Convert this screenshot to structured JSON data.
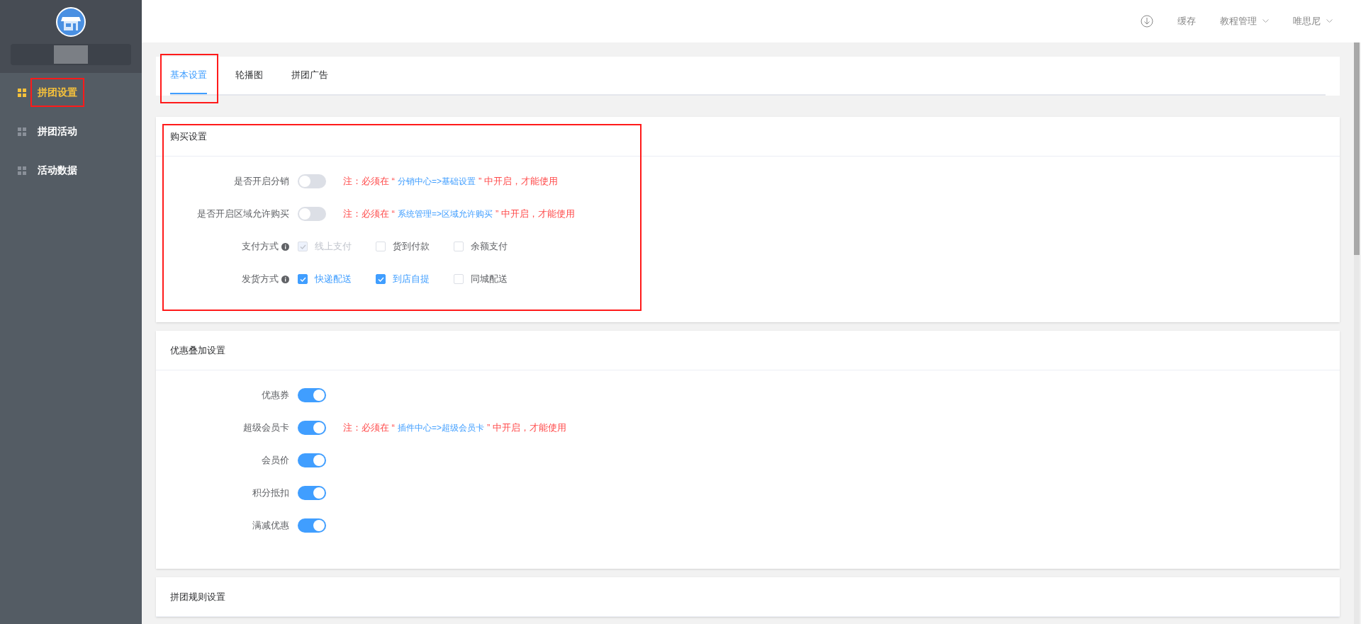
{
  "sidebar": {
    "items": [
      {
        "label": "拼团设置",
        "selected": true,
        "highlighted": true
      },
      {
        "label": "拼团活动",
        "selected": false,
        "highlighted": false
      },
      {
        "label": "活动数据",
        "selected": false,
        "highlighted": false
      }
    ]
  },
  "header": {
    "items": [
      {
        "label": "缓存",
        "dropdown": false
      },
      {
        "label": "教程管理",
        "dropdown": true
      },
      {
        "label": "唯思尼",
        "dropdown": true
      }
    ]
  },
  "tabs": {
    "highlighted": true,
    "items": [
      {
        "label": "基本设置",
        "selected": true
      },
      {
        "label": "轮播图",
        "selected": false
      },
      {
        "label": "拼团广告",
        "selected": false
      }
    ]
  },
  "sections": [
    {
      "title": "购买设置",
      "highlighted": true,
      "rows": [
        {
          "kind": "switch",
          "label": "是否开启分销",
          "info": false,
          "on": false,
          "note": {
            "prefix": "注：必须在 “",
            "link": "分销中心=>基础设置",
            "suffix": "” 中开启，才能使用"
          }
        },
        {
          "kind": "switch",
          "label": "是否开启区域允许购买",
          "info": false,
          "on": false,
          "note": {
            "prefix": "注：必须在 “",
            "link": "系统管理=>区域允许购买",
            "suffix": "” 中开启，才能使用"
          }
        },
        {
          "kind": "checkboxes",
          "label": "支付方式",
          "info": true,
          "options": [
            {
              "label": "线上支付",
              "checked": true,
              "disabled": true
            },
            {
              "label": "货到付款",
              "checked": false,
              "disabled": false
            },
            {
              "label": "余额支付",
              "checked": false,
              "disabled": false
            }
          ]
        },
        {
          "kind": "checkboxes",
          "label": "发货方式",
          "info": true,
          "options": [
            {
              "label": "快递配送",
              "checked": true,
              "disabled": false
            },
            {
              "label": "到店自提",
              "checked": true,
              "disabled": false
            },
            {
              "label": "同城配送",
              "checked": false,
              "disabled": false
            }
          ]
        }
      ]
    },
    {
      "title": "优惠叠加设置",
      "highlighted": false,
      "rows": [
        {
          "kind": "switch",
          "label": "优惠券",
          "info": false,
          "on": true
        },
        {
          "kind": "switch",
          "label": "超级会员卡",
          "info": false,
          "on": true,
          "note": {
            "prefix": "注：必须在 “",
            "link": "插件中心=>超级会员卡",
            "suffix": "” 中开启，才能使用"
          }
        },
        {
          "kind": "switch",
          "label": "会员价",
          "info": false,
          "on": true
        },
        {
          "kind": "switch",
          "label": "积分抵扣",
          "info": false,
          "on": true
        },
        {
          "kind": "switch",
          "label": "满减优惠",
          "info": false,
          "on": true
        }
      ]
    },
    {
      "title": "拼团规则设置",
      "highlighted": false
    }
  ]
}
